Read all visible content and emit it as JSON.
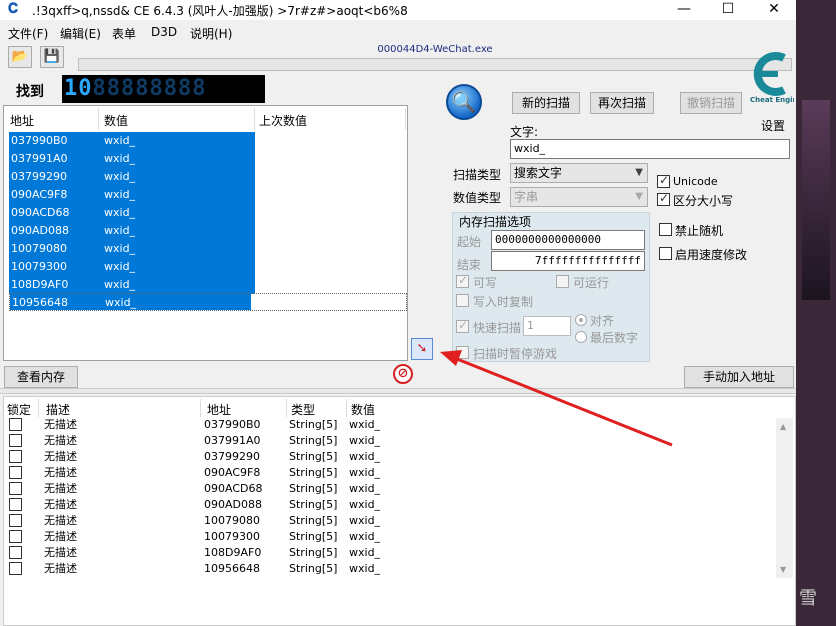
{
  "window": {
    "title": ".!3qxff>q,nssd&  CE 6.4.3 (风叶人-加强版)  >7r#z#>aoqt<b6%8",
    "minimize": "—",
    "maximize": "☐",
    "close": "✕"
  },
  "menu": [
    "文件(F)",
    "编辑(E)",
    "表单",
    "D3D",
    "说明(H)"
  ],
  "process_name": "000044D4-WeChat.exe",
  "found": {
    "label": "找到",
    "count": "10"
  },
  "lcd_digits": "88888888",
  "results": {
    "headers": [
      "地址",
      "数值",
      "上次数值"
    ],
    "rows": [
      {
        "address": "037990B0",
        "value": "wxid_"
      },
      {
        "address": "037991A0",
        "value": "wxid_"
      },
      {
        "address": "03799290",
        "value": "wxid_"
      },
      {
        "address": "090AC9F8",
        "value": "wxid_"
      },
      {
        "address": "090ACD68",
        "value": "wxid_"
      },
      {
        "address": "090AD088",
        "value": "wxid_"
      },
      {
        "address": "10079080",
        "value": "wxid_"
      },
      {
        "address": "10079300",
        "value": "wxid_"
      },
      {
        "address": "108D9AF0",
        "value": "wxid_"
      },
      {
        "address": "10956648",
        "value": "wxid_"
      }
    ]
  },
  "scan": {
    "new_scan": "新的扫描",
    "next_scan": "再次扫描",
    "undo_scan": "撤销扫描",
    "settings": "设置",
    "text_label": "文字:",
    "text_value": "wxid_",
    "scan_type_label": "扫描类型",
    "scan_type_value": "搜索文字",
    "value_type_label": "数值类型",
    "value_type_value": "字串",
    "unicode": "Unicode",
    "case_sensitive": "区分大小写",
    "mem_opts_title": "内存扫描选项",
    "start_label": "起始",
    "start_value": "0000000000000000",
    "stop_label": "结束",
    "stop_value": "7fffffffffffffff",
    "writable": "可写",
    "executable": "可运行",
    "copy_on_write": "写入时复制",
    "fast_scan": "快速扫描",
    "fast_scan_value": "1",
    "alignment": "对齐",
    "last_digits": "最后数字",
    "pause_game": "扫描时暂停游戏",
    "disable_random": "禁止随机",
    "speedhack": "启用速度修改"
  },
  "view_memory": "查看内存",
  "add_address": "手动加入地址",
  "addrlist": {
    "headers": [
      "锁定",
      "描述",
      "地址",
      "类型",
      "数值"
    ],
    "rows": [
      {
        "desc": "无描述",
        "address": "037990B0",
        "type": "String[5]",
        "value": "wxid_"
      },
      {
        "desc": "无描述",
        "address": "037991A0",
        "type": "String[5]",
        "value": "wxid_"
      },
      {
        "desc": "无描述",
        "address": "03799290",
        "type": "String[5]",
        "value": "wxid_"
      },
      {
        "desc": "无描述",
        "address": "090AC9F8",
        "type": "String[5]",
        "value": "wxid_"
      },
      {
        "desc": "无描述",
        "address": "090ACD68",
        "type": "String[5]",
        "value": "wxid_"
      },
      {
        "desc": "无描述",
        "address": "090AD088",
        "type": "String[5]",
        "value": "wxid_"
      },
      {
        "desc": "无描述",
        "address": "10079080",
        "type": "String[5]",
        "value": "wxid_"
      },
      {
        "desc": "无描述",
        "address": "10079300",
        "type": "String[5]",
        "value": "wxid_"
      },
      {
        "desc": "无描述",
        "address": "108D9AF0",
        "type": "String[5]",
        "value": "wxid_"
      },
      {
        "desc": "无描述",
        "address": "10956648",
        "type": "String[5]",
        "value": "wxid_"
      }
    ]
  },
  "colors": {
    "selection": "#0078d7",
    "annotation_arrow": "#e02020",
    "lcd_on": "#2aa7ff"
  },
  "logo_text": "Cheat Engine",
  "edge_glyph": "雪"
}
